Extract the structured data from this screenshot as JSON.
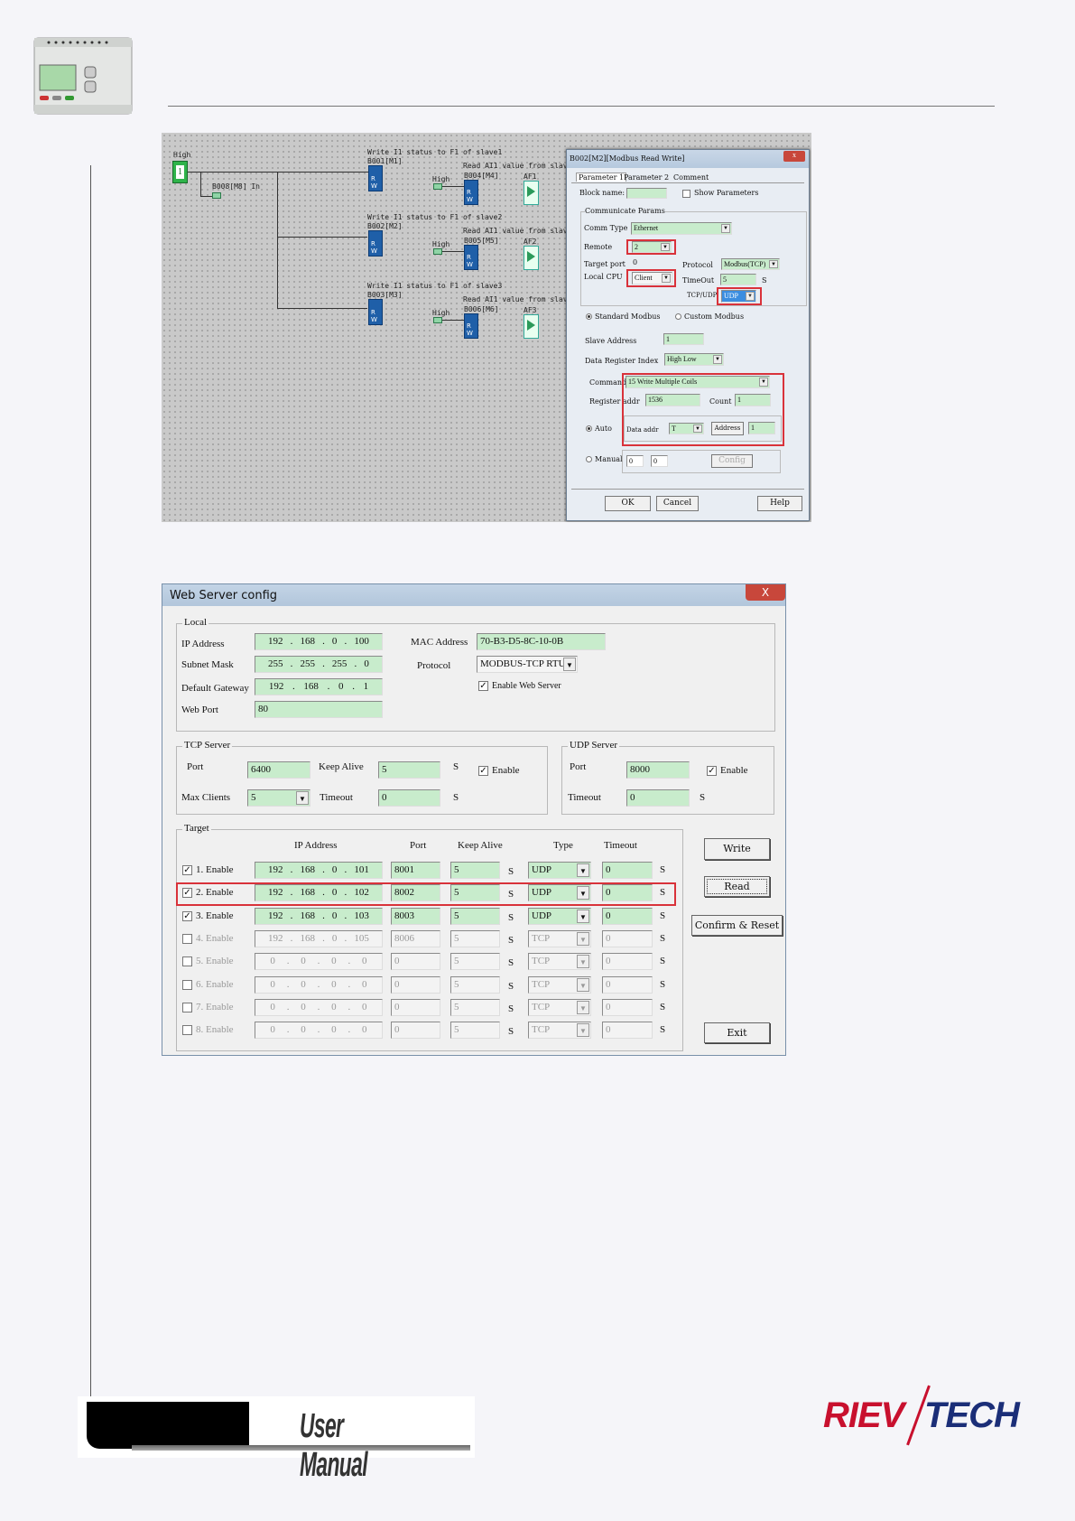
{
  "header": {
    "device_image": "plc-device-icon"
  },
  "diagram": {
    "high_label": "High",
    "high_value": "1",
    "b008": "B008[M8] In",
    "rows": [
      {
        "write_title": "Write I1 status to F1 of slave1",
        "write_block": "B001[M1]",
        "read_title": "Read AI1 value from slave1",
        "read_block": "B004[M4]",
        "high": "High",
        "af": "AF1"
      },
      {
        "write_title": "Write I1 status to F1 of slave2",
        "write_block": "B002[M2]",
        "read_title": "Read AI1 value from slave2",
        "read_block": "B005[M5]",
        "high": "High",
        "af": "AF2"
      },
      {
        "write_title": "Write I1 status to F1 of slave3",
        "write_block": "B003[M3]",
        "read_title": "Read AI1 value from slave3",
        "read_block": "B006[M6]",
        "high": "High",
        "af": "AF3"
      }
    ],
    "block_rw": "R W",
    "af_letter": "F"
  },
  "modbus_dialog": {
    "title": "B002[M2][Modbus Read Write]",
    "close": "x",
    "tabs": [
      "Parameter 1",
      "Parameter 2",
      "Comment"
    ],
    "block_name_label": "Block name:",
    "block_name": "",
    "show_params": "Show Parameters",
    "group": "Communicate Params",
    "comm_type_label": "Comm Type",
    "comm_type": "Ethernet",
    "remote_label": "Remote",
    "remote": "2",
    "target_port_label": "Target port",
    "target_port": "0",
    "protocol_label": "Protocol",
    "protocol": "Modbus(TCP)",
    "local_cpu_label": "Local CPU",
    "local_cpu": "Client",
    "timeout_label": "TimeOut",
    "timeout": "5",
    "timeout_unit": "S",
    "tcpudp_label": "TCP/UDP",
    "tcpudp": "UDP",
    "standard": "Standard Modbus",
    "custom": "Custom Modbus",
    "slave_label": "Slave Address",
    "slave": "1",
    "dri_label": "Data Register Index",
    "dri": "High Low",
    "command_label": "Command",
    "command": "15 Write Multiple Coils",
    "reg_label": "Register addr",
    "reg": "1536",
    "count_label": "Count",
    "count": "1",
    "auto": "Auto",
    "data_addr_label": "Data addr",
    "data_addr": "T",
    "address_btn": "Address",
    "address": "1",
    "manual": "Manual",
    "manual_a": "0",
    "manual_b": "0",
    "config": "Config",
    "ok": "OK",
    "cancel": "Cancel",
    "help": "Help"
  },
  "web": {
    "title": "Web Server config",
    "close": "X",
    "local": {
      "label": "Local",
      "ip_label": "IP Address",
      "ip": [
        "192",
        "168",
        "0",
        "100"
      ],
      "mask_label": "Subnet Mask",
      "mask": [
        "255",
        "255",
        "255",
        "0"
      ],
      "gw_label": "Default Gateway",
      "gw": [
        "192",
        "168",
        "0",
        "1"
      ],
      "port_label": "Web Port",
      "port": "80",
      "mac_label": "MAC Address",
      "mac": "70-B3-D5-8C-10-0B",
      "protocol_label": "Protocol",
      "protocol": "MODBUS-TCP RTU",
      "enable_web": "Enable Web Server"
    },
    "tcp": {
      "label": "TCP Server",
      "port_label": "Port",
      "port": "6400",
      "ka_label": "Keep Alive",
      "ka": "5",
      "s": "S",
      "enable": "Enable",
      "max_label": "Max Clients",
      "max": "5",
      "timeout_label": "Timeout",
      "timeout": "0"
    },
    "udp": {
      "label": "UDP Server",
      "port_label": "Port",
      "port": "8000",
      "enable": "Enable",
      "timeout_label": "Timeout",
      "timeout": "0",
      "s": "S"
    },
    "target": {
      "label": "Target",
      "headers": [
        "IP Address",
        "Port",
        "Keep Alive",
        "Type",
        "Timeout"
      ],
      "rows": [
        {
          "enabled": true,
          "label": "1. Enable",
          "ip": [
            "192",
            "168",
            "0",
            "101"
          ],
          "port": "8001",
          "ka": "5",
          "type": "UDP",
          "timeout": "0"
        },
        {
          "enabled": true,
          "label": "2. Enable",
          "ip": [
            "192",
            "168",
            "0",
            "102"
          ],
          "port": "8002",
          "ka": "5",
          "type": "UDP",
          "timeout": "0"
        },
        {
          "enabled": true,
          "label": "3. Enable",
          "ip": [
            "192",
            "168",
            "0",
            "103"
          ],
          "port": "8003",
          "ka": "5",
          "type": "UDP",
          "timeout": "0"
        },
        {
          "enabled": false,
          "label": "4. Enable",
          "ip": [
            "192",
            "168",
            "0",
            "105"
          ],
          "port": "8006",
          "ka": "5",
          "type": "TCP",
          "timeout": "0"
        },
        {
          "enabled": false,
          "label": "5. Enable",
          "ip": [
            "0",
            "0",
            "0",
            "0"
          ],
          "port": "0",
          "ka": "5",
          "type": "TCP",
          "timeout": "0"
        },
        {
          "enabled": false,
          "label": "6. Enable",
          "ip": [
            "0",
            "0",
            "0",
            "0"
          ],
          "port": "0",
          "ka": "5",
          "type": "TCP",
          "timeout": "0"
        },
        {
          "enabled": false,
          "label": "7. Enable",
          "ip": [
            "0",
            "0",
            "0",
            "0"
          ],
          "port": "0",
          "ka": "5",
          "type": "TCP",
          "timeout": "0"
        },
        {
          "enabled": false,
          "label": "8. Enable",
          "ip": [
            "0",
            "0",
            "0",
            "0"
          ],
          "port": "0",
          "ka": "5",
          "type": "TCP",
          "timeout": "0"
        }
      ],
      "unit": "S"
    },
    "buttons": {
      "write": "Write",
      "read": "Read",
      "confirm": "Confirm & Reset",
      "exit": "Exit"
    }
  },
  "footer": {
    "manual": "User Manual",
    "logo_left": "RIEV",
    "logo_right": "TECH"
  },
  "colors": {
    "field_green": "#c8eccc",
    "highlight_red": "#d9323a",
    "logo_red": "#c8102e",
    "logo_blue": "#1b2e78"
  }
}
